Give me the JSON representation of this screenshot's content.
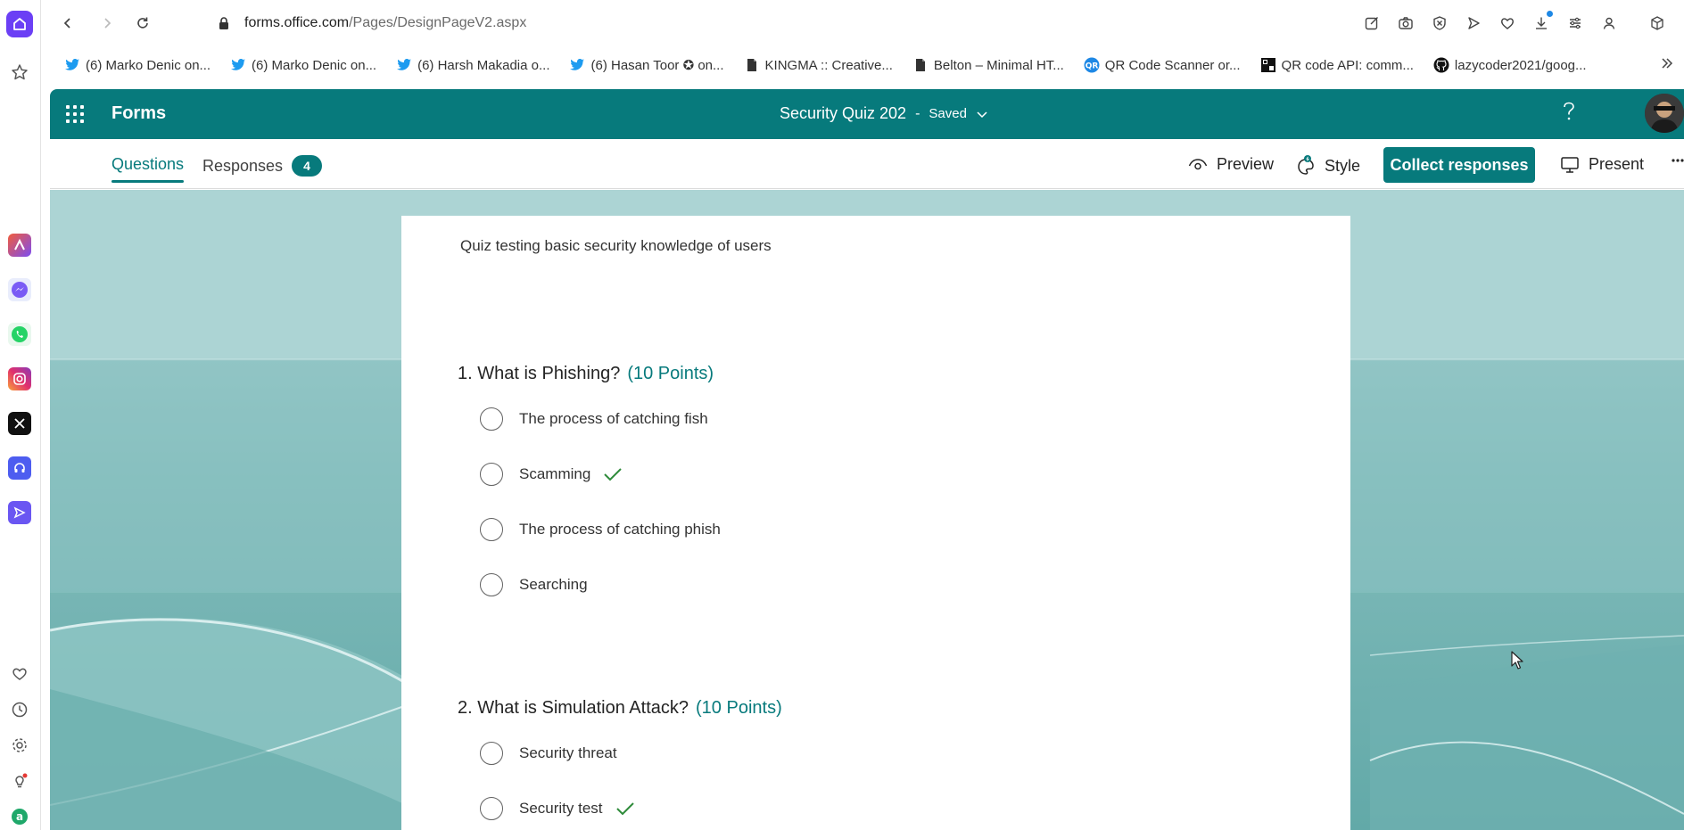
{
  "browser": {
    "url_host": "forms.office.com",
    "url_path": "/Pages/DesignPageV2.aspx"
  },
  "bookmarks": [
    {
      "label": "(6) Marko Denic on...",
      "icon": "twitter-icon"
    },
    {
      "label": "(6) Marko Denic on...",
      "icon": "twitter-icon"
    },
    {
      "label": "(6) Harsh Makadia o...",
      "icon": "twitter-icon"
    },
    {
      "label": "(6) Hasan Toor ✪ on...",
      "icon": "twitter-icon"
    },
    {
      "label": "KINGMA :: Creative...",
      "icon": "document-icon"
    },
    {
      "label": "Belton – Minimal HT...",
      "icon": "document-icon"
    },
    {
      "label": "QR Code Scanner or...",
      "icon": "qr-scanner-icon"
    },
    {
      "label": "QR code API: comm...",
      "icon": "qr-api-icon"
    },
    {
      "label": "lazycoder2021/goog...",
      "icon": "github-icon"
    }
  ],
  "header": {
    "app_name": "Forms",
    "doc_title": "Security Quiz 202",
    "separator": "-",
    "save_status": "Saved"
  },
  "tabs": {
    "questions": "Questions",
    "responses": "Responses",
    "responses_count": "4"
  },
  "commands": {
    "preview": "Preview",
    "style": "Style",
    "collect": "Collect responses",
    "present": "Present"
  },
  "form": {
    "description": "Quiz testing basic security knowledge of users",
    "questions": [
      {
        "title": "1. What is Phishing?",
        "points": "(10 Points)",
        "options": [
          {
            "label": "The process of catching fish",
            "correct": false
          },
          {
            "label": "Scamming",
            "correct": true
          },
          {
            "label": "The process of catching phish",
            "correct": false
          },
          {
            "label": "Searching",
            "correct": false
          }
        ]
      },
      {
        "title": "2. What is Simulation Attack?",
        "points": "(10 Points)",
        "options": [
          {
            "label": "Security threat",
            "correct": false
          },
          {
            "label": "Security test",
            "correct": true
          }
        ]
      }
    ]
  },
  "colors": {
    "brand": "#077a7c",
    "check": "#2e8b3a",
    "sidebar_home": "#6b3ff5"
  }
}
